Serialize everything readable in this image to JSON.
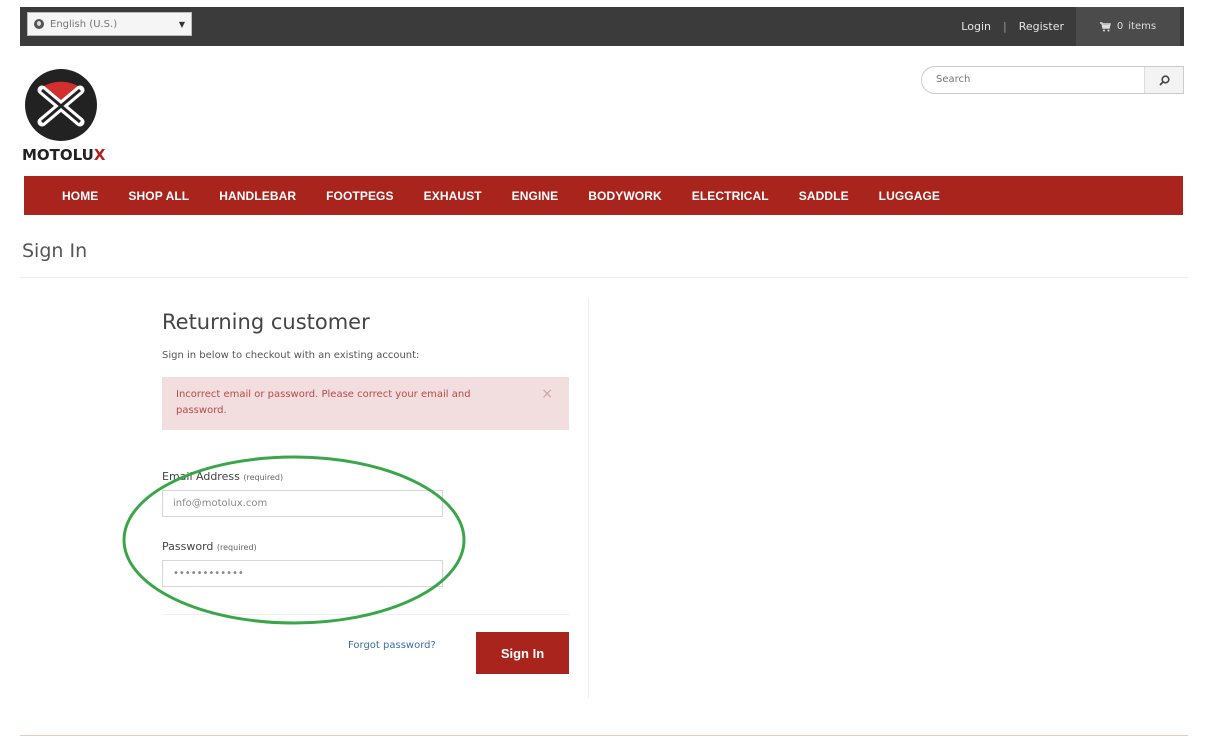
{
  "topbar": {
    "language": "English (U.S.)",
    "login": "Login",
    "separator": "|",
    "register": "Register",
    "cart_count": "0",
    "cart_label": "items",
    "icons": {
      "language": "globe-icon",
      "dropdown": "caret-down-icon",
      "cart": "cart-icon"
    }
  },
  "brand": {
    "logo_text_a": "MOTOLU",
    "logo_text_b": "X",
    "colors": {
      "accent": "#a9241d",
      "logo_red": "#d32f2f"
    }
  },
  "search": {
    "placeholder": "Search",
    "icon": "search-icon"
  },
  "nav": {
    "items": [
      "HOME",
      "SHOP ALL",
      "HANDLEBAR",
      "FOOTPEGS",
      "EXHAUST",
      "ENGINE",
      "BODYWORK",
      "ELECTRICAL",
      "SADDLE",
      "LUGGAGE"
    ]
  },
  "page": {
    "title": "Sign In"
  },
  "form": {
    "title": "Returning customer",
    "subtitle": "Sign in below to checkout with an existing account:",
    "alert": "Incorrect email or password. Please correct your email and password.",
    "alert_close": "×",
    "email_label": "Email Address",
    "email_required": "(required)",
    "email_value": "info@motolux.com",
    "password_label": "Password",
    "password_required": "(required)",
    "password_value": "••••••••••••",
    "forgot": "Forgot password?",
    "submit": "Sign In"
  }
}
